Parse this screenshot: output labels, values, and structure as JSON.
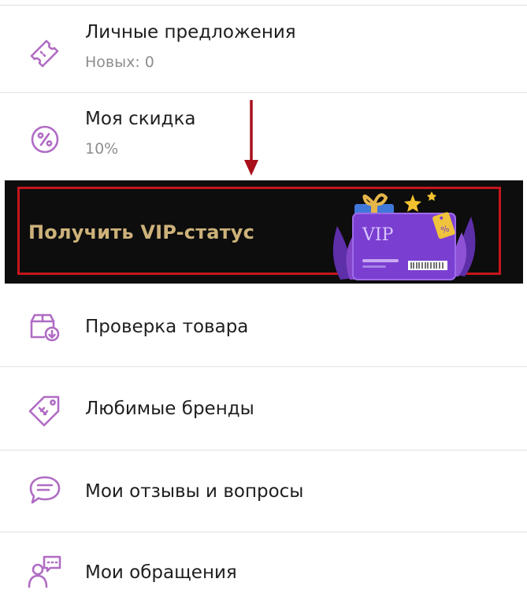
{
  "menu": {
    "offers": {
      "title": "Личные предложения",
      "subtitle": "Новых: 0"
    },
    "discount": {
      "title": "Моя скидка",
      "subtitle": "10%"
    },
    "vip": {
      "label": "Получить VIP-статус",
      "card_text": "VIP",
      "tag_text": "%"
    },
    "product_check": {
      "title": "Проверка товара"
    },
    "brands": {
      "title": "Любимые бренды"
    },
    "reviews": {
      "title": "Мои отзывы и вопросы"
    },
    "requests": {
      "title": "Мои обращения"
    }
  },
  "colors": {
    "icon": "#b06cc4",
    "arrow": "#a8101a",
    "vip_bg": "#0d0d0d",
    "vip_frame": "#c4161c",
    "vip_text": "#cdb27a",
    "vip_card": "#7a3fd1"
  },
  "icons": {
    "offers": "ticket-icon",
    "discount": "percent-icon",
    "product_check": "box-download-icon",
    "brands": "tag-icon",
    "reviews": "chat-icon",
    "requests": "support-icon"
  }
}
